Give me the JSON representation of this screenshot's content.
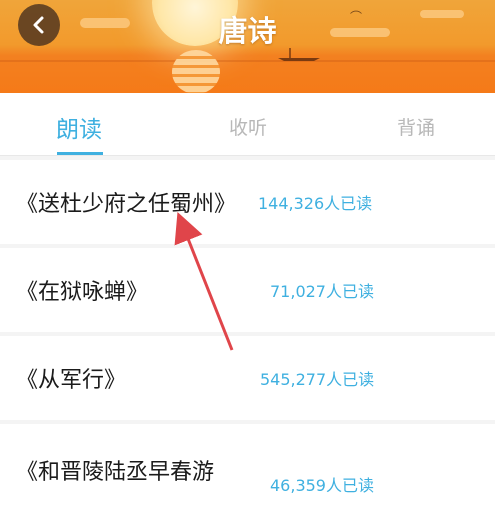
{
  "header": {
    "title": "唐诗",
    "back_icon": "chevron-left-icon"
  },
  "tabs": [
    {
      "label": "朗读",
      "active": true
    },
    {
      "label": "收听",
      "active": false
    },
    {
      "label": "背诵",
      "active": false
    }
  ],
  "poems": [
    {
      "title": "《送杜少府之任蜀州》",
      "count": "144,326人已读"
    },
    {
      "title": "《在狱咏蝉》",
      "count": "71,027人已读"
    },
    {
      "title": "《从军行》",
      "count": "545,277人已读"
    },
    {
      "title": "《和晋陵陆丞早春游",
      "count": "46,359人已读"
    }
  ],
  "colors": {
    "accent": "#3fb0e0",
    "header_orange": "#f38020",
    "annotation_arrow": "#e0454a"
  }
}
